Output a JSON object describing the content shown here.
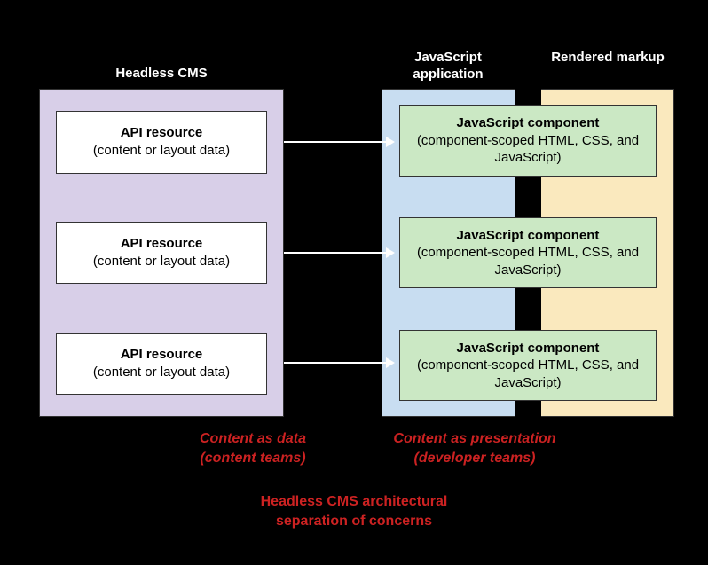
{
  "chart_data": {
    "type": "diagram",
    "title": "Headless CMS architectural separation of concerns",
    "left_panel": {
      "heading": "Headless CMS",
      "boxes": [
        {
          "title": "API resource",
          "sub": "(content or layout data)"
        },
        {
          "title": "API resource",
          "sub": "(content or layout data)"
        },
        {
          "title": "API resource",
          "sub": "(content or layout data)"
        }
      ]
    },
    "right_panel": {
      "heading_blue": "JavaScript application",
      "heading_yellow": "Rendered markup",
      "boxes": [
        {
          "title": "JavaScript component",
          "sub": "(component-scoped HTML, CSS, and JavaScript)"
        },
        {
          "title": "JavaScript component",
          "sub": "(component-scoped HTML, CSS, and JavaScript)"
        },
        {
          "title": "JavaScript component",
          "sub": "(component-scoped HTML, CSS, and JavaScript)"
        }
      ]
    },
    "captions": {
      "left": "Content as data\n(content teams)",
      "right": "Content as presentation\n(developer teams)",
      "bottom": "Headless CMS architectural\nseparation of concerns"
    },
    "arrows": [
      {
        "from": "api-resource-0",
        "to": "js-component-0"
      },
      {
        "from": "api-resource-1",
        "to": "js-component-1"
      },
      {
        "from": "api-resource-2",
        "to": "js-component-2"
      }
    ]
  }
}
